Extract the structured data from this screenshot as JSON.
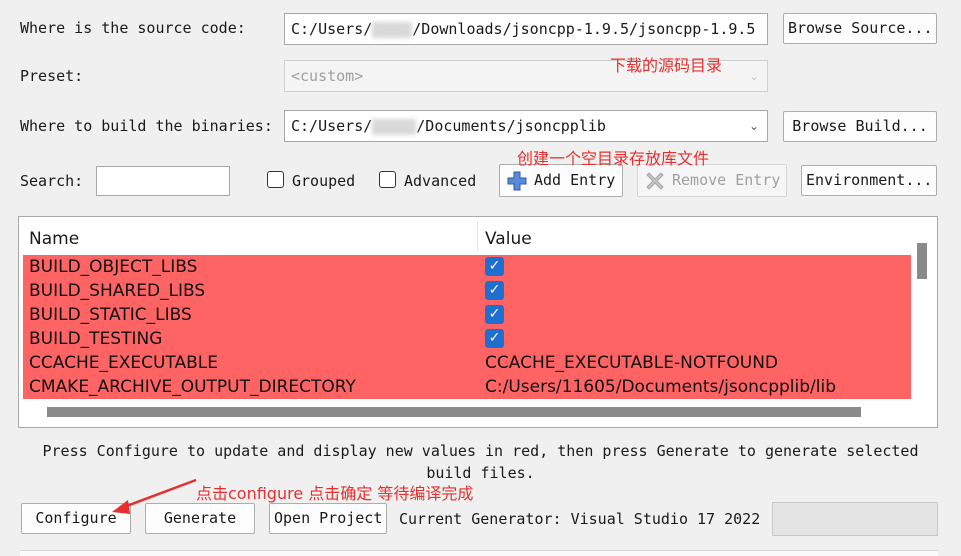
{
  "source": {
    "label": "Where is the source code:",
    "path_before": "C:/Users/",
    "path_after": "/Downloads/jsoncpp-1.9.5/jsoncpp-1.9.5",
    "browse_label": "Browse Source..."
  },
  "preset": {
    "label": "Preset:",
    "value": "<custom>"
  },
  "build": {
    "label": "Where to build the binaries:",
    "path_before": "C:/Users/",
    "path_after": "/Documents/jsoncpplib",
    "browse_label": "Browse Build..."
  },
  "toolbar": {
    "search_label": "Search:",
    "search_value": "",
    "grouped_label": "Grouped",
    "advanced_label": "Advanced",
    "add_entry_label": "Add Entry",
    "remove_entry_label": "Remove Entry",
    "environment_label": "Environment..."
  },
  "table": {
    "headers": [
      "Name",
      "Value"
    ],
    "rows": [
      {
        "name": "BUILD_OBJECT_LIBS",
        "value": "",
        "checked": true
      },
      {
        "name": "BUILD_SHARED_LIBS",
        "value": "",
        "checked": true
      },
      {
        "name": "BUILD_STATIC_LIBS",
        "value": "",
        "checked": true
      },
      {
        "name": "BUILD_TESTING",
        "value": "",
        "checked": true
      },
      {
        "name": "CCACHE_EXECUTABLE",
        "value": "CCACHE_EXECUTABLE-NOTFOUND",
        "checked": false
      },
      {
        "name": "CMAKE_ARCHIVE_OUTPUT_DIRECTORY",
        "value": "C:/Users/11605/Documents/jsoncpplib/lib",
        "checked": false
      }
    ],
    "row_highlight_color": "#ff6464",
    "checkbox_color": "#1e6fd0"
  },
  "help_text": {
    "line1": "Press Configure to update and display new values in red, then press Generate to generate selected",
    "line2": "build files."
  },
  "bottom": {
    "configure_label": "Configure",
    "generate_label": "Generate",
    "open_project_label": "Open Project",
    "generator_text": "Current Generator: Visual Studio 17 2022"
  },
  "annotations": {
    "source_note": "下载的源码目录",
    "build_note": "创建一个空目录存放库文件",
    "configure_note": "点击configure 点击确定 等待编译完成",
    "color": "#e53030"
  },
  "icons": {
    "add_entry": "plus-icon",
    "remove_entry": "cross-icon",
    "dropdown": "chevron-down-icon"
  }
}
